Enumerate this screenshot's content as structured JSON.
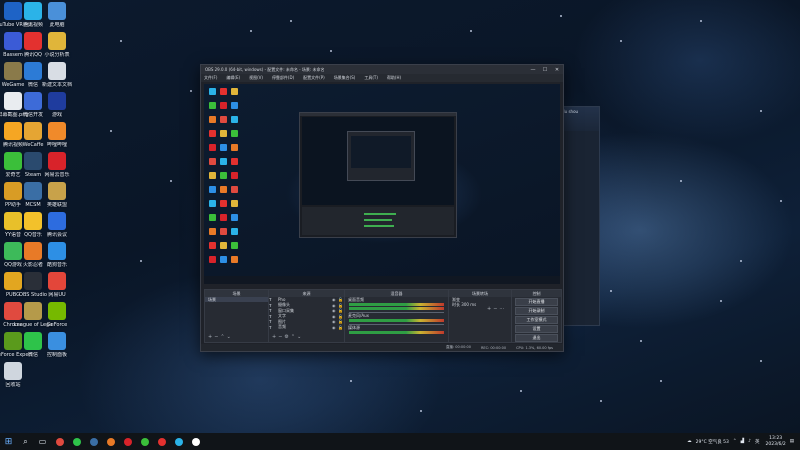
{
  "desktop": {
    "icons": [
      {
        "label": "YouTube VR 回放",
        "color": "#1e63c6"
      },
      {
        "label": "腾讯视频",
        "color": "#2bb3e8"
      },
      {
        "label": "此电脑",
        "color": "#4a90d9"
      },
      {
        "label": "Bassem",
        "color": "#3b5bd6"
      },
      {
        "label": "腾讯QQ",
        "color": "#e3312f"
      },
      {
        "label": "小说分析表",
        "color": "#e0b53a"
      },
      {
        "label": "WeGame",
        "color": "#8a7a4a"
      },
      {
        "label": "微信",
        "color": "#2c7bd6"
      },
      {
        "label": "新建文本文档",
        "color": "#d8dde4"
      },
      {
        "label": "屏幕截图.png",
        "color": "#e9ecf0"
      },
      {
        "label": "微信开发",
        "color": "#3d6bd8"
      },
      {
        "label": "游戏",
        "color": "#1f3c9e"
      },
      {
        "label": "腾讯视频",
        "color": "#f5a623"
      },
      {
        "label": "WeCaffe",
        "color": "#e5a533"
      },
      {
        "label": "哔哩哔哩",
        "color": "#f08a2a"
      },
      {
        "label": "爱奇艺",
        "color": "#3bbf3a"
      },
      {
        "label": "Steam",
        "color": "#2a4a6e"
      },
      {
        "label": "网易云音乐",
        "color": "#d8232a"
      },
      {
        "label": "PP助手",
        "color": "#d89c25"
      },
      {
        "label": "MCSM",
        "color": "#3a6ea5"
      },
      {
        "label": "英雄联盟",
        "color": "#c8a24a"
      },
      {
        "label": "YY语音",
        "color": "#e8c02a"
      },
      {
        "label": "QQ音乐",
        "color": "#f3c12b"
      },
      {
        "label": "腾讯会议",
        "color": "#2d6cdf"
      },
      {
        "label": "QQ游戏",
        "color": "#3dba5a"
      },
      {
        "label": "火影忍者",
        "color": "#e87a27"
      },
      {
        "label": "酷狗音乐",
        "color": "#2d8fe5"
      },
      {
        "label": "PUBG",
        "color": "#e2a620"
      },
      {
        "label": "OBS Studio",
        "color": "#2a2f38"
      },
      {
        "label": "网易UU",
        "color": "#e3463a"
      },
      {
        "label": "Chrome",
        "color": "#e04a3f"
      },
      {
        "label": "League of Legends",
        "color": "#b59a4a"
      },
      {
        "label": "GeForce",
        "color": "#76b900"
      },
      {
        "label": "GeForce Experience",
        "color": "#5a9a1c"
      },
      {
        "label": "微信",
        "color": "#2ec34a"
      },
      {
        "label": "控制面板",
        "color": "#3a8fe0"
      },
      {
        "label": "回收站",
        "color": "#cfd6de"
      }
    ]
  },
  "obs": {
    "title": "OBS 29.0.0 (64-bit, windows) - 配置文件: 未命名 - 场景: 未命名",
    "window_buttons": [
      "—",
      "☐",
      "✕"
    ],
    "menu": [
      "文件(F)",
      "编辑(E)",
      "视图(V)",
      "停靠部件(D)",
      "配置文件(P)",
      "场景集合(S)",
      "工具(T)",
      "帮助(H)"
    ],
    "docks": {
      "scenes": {
        "header": "场景",
        "items": [
          "场景"
        ]
      },
      "sources": {
        "header": "来源",
        "items": [
          "Pho",
          "摄像头",
          "窗口采集",
          "文字",
          "图片",
          "音频"
        ]
      },
      "mixer": {
        "header": "混音器",
        "channels": [
          {
            "label": "桌面音频",
            "db": "0.0 dB"
          },
          {
            "label": "麦克风/Aux",
            "db": "0.0 dB"
          },
          {
            "label": "媒体源",
            "db": "0.0 dB"
          }
        ]
      },
      "transitions": {
        "header": "场景转场",
        "fade": "渐变",
        "duration_label": "时长",
        "duration": "300 ms"
      },
      "controls": {
        "header": "控制",
        "buttons": [
          "开始直播",
          "开始录制",
          "工作室模式",
          "设置",
          "退出"
        ]
      }
    },
    "status": {
      "live": "直播: 00:00:00",
      "rec": "REC: 00:00:00",
      "cpu": "CPU: 1.3%, 60.00 fps"
    }
  },
  "taskbar": {
    "start_icon": "windows-icon",
    "search_icon": "search-icon",
    "weather": "29°C 空气良 53",
    "language": "英",
    "time": "13:23",
    "date": "2023/6/2"
  }
}
